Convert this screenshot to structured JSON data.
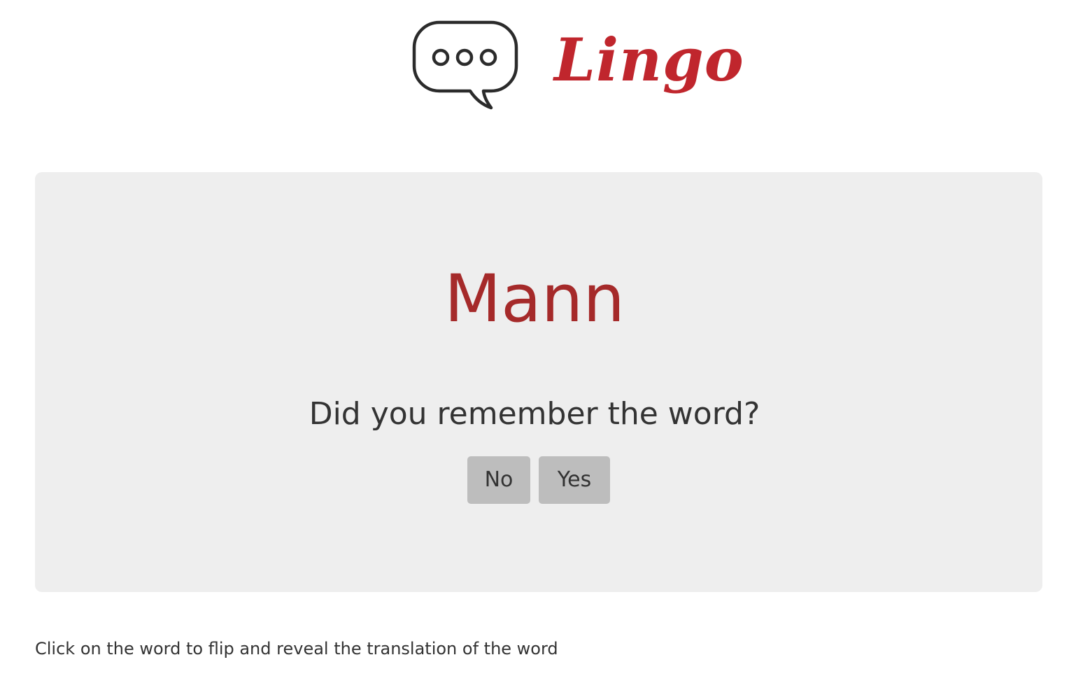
{
  "header": {
    "logo_icon": "speech-bubble-icon",
    "brand_name": "Lingo",
    "brand_color": "#c0262d"
  },
  "flashcard": {
    "word": "Mann",
    "word_color": "#a52a2a",
    "question": "Did you remember the word?",
    "no_label": "No",
    "yes_label": "Yes",
    "card_bg": "#eeeeee",
    "button_bg": "#bdbdbd"
  },
  "footer": {
    "hint": "Click on the word to flip and reveal the translation of the word"
  }
}
